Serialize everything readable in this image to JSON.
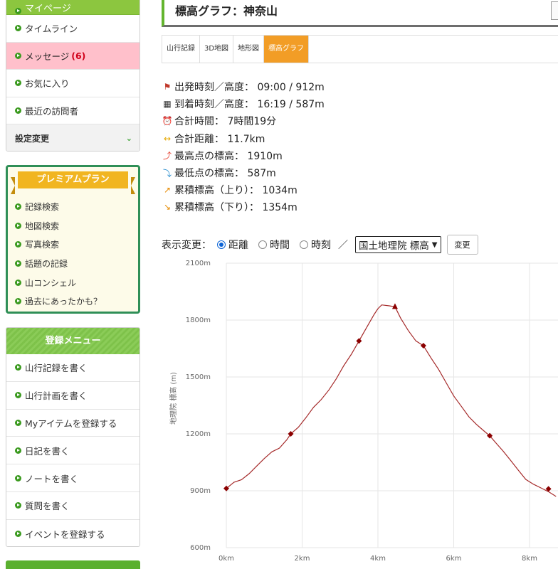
{
  "sidebar": {
    "top_partial_label": "マイページ",
    "items": [
      {
        "label": "タイムライン"
      },
      {
        "label": "メッセージ",
        "count": "(6)"
      },
      {
        "label": "お気に入り"
      },
      {
        "label": "最近の訪問者"
      }
    ],
    "settings_label": "設定変更",
    "premium": {
      "title": "プレミアムプラン",
      "items": [
        "記録検索",
        "地図検索",
        "写真検索",
        "話題の記録",
        "山コンシェル",
        "過去にあったかも？"
      ]
    },
    "register": {
      "title": "登録メニュー",
      "items": [
        "山行記録を書く",
        "山行計画を書く",
        "Myアイテムを登録する",
        "日記を書く",
        "ノートを書く",
        "質問を書く",
        "イベントを登録する"
      ]
    }
  },
  "main": {
    "title": "標高グラフ：神奈山",
    "tabs": [
      "山行記録",
      "3D地図",
      "地形図",
      "標高グラフ"
    ],
    "stats": [
      {
        "icon": "start-flag-icon",
        "glyph": "⚑",
        "color": "#c0392b",
        "text": "出発時刻／高度： 09:00 / 912m"
      },
      {
        "icon": "goal-flag-icon",
        "glyph": "▦",
        "color": "#333333",
        "text": "到着時刻／高度： 16:19 / 587m"
      },
      {
        "icon": "clock-icon",
        "glyph": "⏰",
        "color": "#d9534f",
        "text": "合計時間： 7時間19分"
      },
      {
        "icon": "distance-icon",
        "glyph": "↔",
        "color": "#e6a800",
        "text": "合計距離： 11.7km"
      },
      {
        "icon": "highest-point-icon",
        "glyph": "⤴",
        "color": "#e74c3c",
        "text": "最高点の標高： 1910m"
      },
      {
        "icon": "lowest-point-icon",
        "glyph": "⤵",
        "color": "#2c8fcf",
        "text": "最低点の標高： 587m"
      },
      {
        "icon": "ascent-icon",
        "glyph": "↗",
        "color": "#e68a00",
        "text": "累積標高（上り）： 1034m"
      },
      {
        "icon": "descent-icon",
        "glyph": "↘",
        "color": "#e68a00",
        "text": "累積標高（下り）： 1354m"
      }
    ],
    "controls": {
      "label": "表示変更：",
      "options": [
        "距離",
        "時間",
        "時刻"
      ],
      "selected_index": 0,
      "separator": "／",
      "select_value": "国土地理院 標高",
      "button": "変更"
    }
  },
  "chart_data": {
    "type": "line",
    "ylabel": "地理院 標高 (m)",
    "ylim": [
      600,
      2100
    ],
    "xlim": [
      0,
      8.7
    ],
    "yticks": [
      "600m",
      "900m",
      "1200m",
      "1500m",
      "1800m",
      "2100m"
    ],
    "xticks": [
      "0km",
      "2km",
      "4km",
      "6km",
      "8km"
    ],
    "grid": true,
    "line_color": "#a52a2a",
    "series": [
      {
        "x": [
          0,
          0.2,
          0.4,
          0.6,
          0.8,
          1.0,
          1.2,
          1.4,
          1.6,
          1.7,
          1.9,
          2.1,
          2.3,
          2.5,
          2.7,
          2.9,
          3.1,
          3.3,
          3.5,
          3.7,
          3.9,
          4.0,
          4.1,
          4.3,
          4.45,
          4.6,
          4.8,
          5.0,
          5.2,
          5.4,
          5.6,
          5.8,
          6.0,
          6.2,
          6.4,
          6.6,
          6.8,
          6.95,
          7.1,
          7.3,
          7.5,
          7.7,
          7.9,
          8.1,
          8.3,
          8.5,
          8.7
        ],
        "y": [
          912,
          945,
          958,
          990,
          1030,
          1070,
          1105,
          1125,
          1170,
          1200,
          1235,
          1285,
          1340,
          1380,
          1430,
          1490,
          1560,
          1620,
          1690,
          1760,
          1830,
          1860,
          1880,
          1875,
          1870,
          1810,
          1745,
          1690,
          1665,
          1600,
          1540,
          1470,
          1400,
          1345,
          1290,
          1250,
          1215,
          1190,
          1155,
          1110,
          1060,
          1010,
          960,
          935,
          915,
          895,
          870
        ]
      }
    ],
    "markers": [
      {
        "x": 0,
        "y": 912,
        "shape": "diamond"
      },
      {
        "x": 1.7,
        "y": 1200,
        "shape": "diamond"
      },
      {
        "x": 3.5,
        "y": 1690,
        "shape": "diamond"
      },
      {
        "x": 4.45,
        "y": 1870,
        "shape": "triangle"
      },
      {
        "x": 5.2,
        "y": 1665,
        "shape": "diamond"
      },
      {
        "x": 6.95,
        "y": 1190,
        "shape": "diamond"
      },
      {
        "x": 8.5,
        "y": 910,
        "shape": "diamond"
      }
    ]
  }
}
